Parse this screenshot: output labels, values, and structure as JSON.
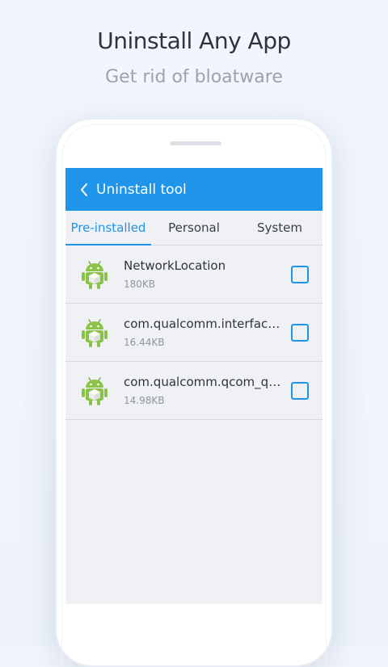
{
  "promo": {
    "title": "Uninstall Any App",
    "subtitle": "Get rid of bloatware"
  },
  "appbar": {
    "back_icon": "chevron-left-icon",
    "title": "Uninstall tool"
  },
  "tabs": [
    {
      "label": "Pre-installed",
      "active": true
    },
    {
      "label": "Personal",
      "active": false
    },
    {
      "label": "System",
      "active": false
    }
  ],
  "apps": [
    {
      "name": "NetworkLocation",
      "size": "180KB",
      "icon": "android-package-icon",
      "checked": false
    },
    {
      "name": "com.qualcomm.interfacepermissions",
      "size": "16.44KB",
      "icon": "android-package-icon",
      "checked": false
    },
    {
      "name": "com.qualcomm.qcom_qmi",
      "size": "14.98KB",
      "icon": "android-package-icon",
      "checked": false
    }
  ],
  "colors": {
    "accent": "#1e95e8",
    "android_green": "#8bc34a",
    "background": "#eff1f4"
  }
}
